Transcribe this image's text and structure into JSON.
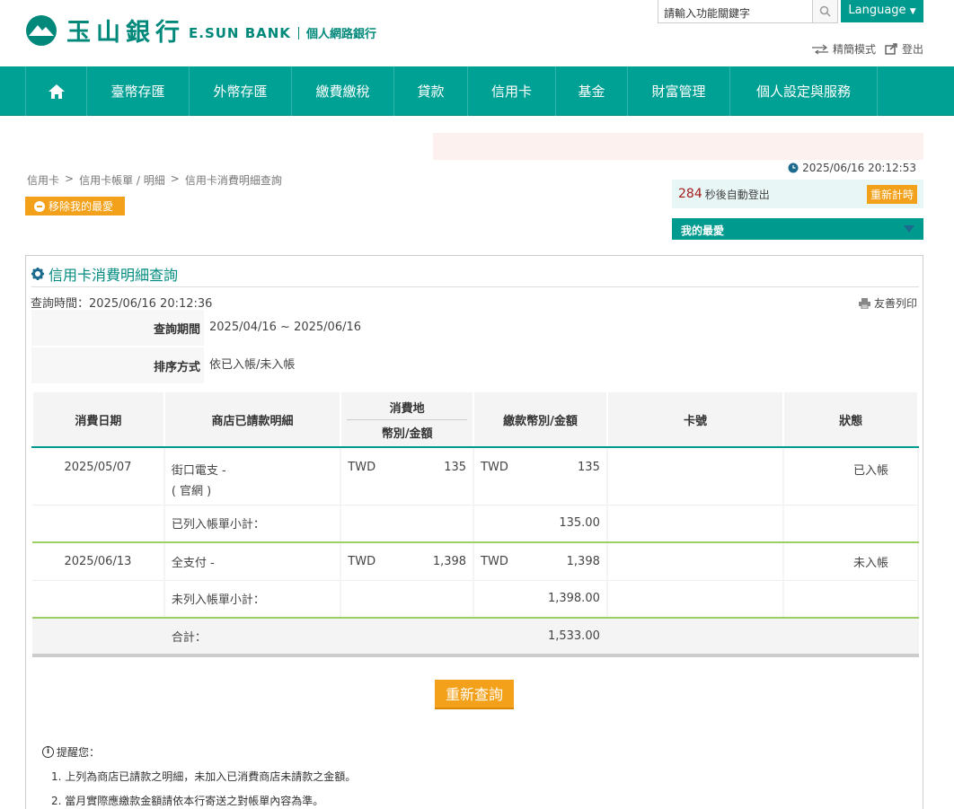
{
  "header": {
    "logo_cn": "玉山銀行",
    "logo_en": "E.SUN BANK",
    "logo_sub": "個人網路銀行",
    "search_placeholder": "請輸入功能關鍵字",
    "language_label": "Language",
    "simple_mode_label": "精簡模式",
    "logout_label": "登出"
  },
  "nav": {
    "items": [
      "臺幣存匯",
      "外幣存匯",
      "繳費繳稅",
      "貸款",
      "信用卡",
      "基金",
      "財富管理",
      "個人設定與服務"
    ]
  },
  "session": {
    "timestamp": "2025/06/16 20:12:53",
    "countdown": "284",
    "countdown_text": "秒後自動登出",
    "reset_label": "重新計時",
    "favorites_label": "我的最愛"
  },
  "breadcrumb": [
    "信用卡",
    "信用卡帳單 / 明細",
    "信用卡消費明細查詢"
  ],
  "remove_favorite_label": "移除我的最愛",
  "panel": {
    "title": "信用卡消費明細查詢",
    "query_time": "查詢時間：2025/06/16 20:12:36",
    "print_label": "友善列印",
    "period_label": "查詢期間",
    "period_value": "2025/04/16 ~ 2025/06/16",
    "sort_label": "排序方式",
    "sort_value": "依已入帳/未入帳"
  },
  "table": {
    "headers": {
      "date": "消費日期",
      "detail": "商店已請款明細",
      "place_top": "消費地",
      "place_bottom": "幣別/金額",
      "pay": "繳款幣別/金額",
      "card": "卡號",
      "status": "狀態"
    },
    "rows": [
      {
        "date": "2025/05/07",
        "detail_line1": "街口電支 -",
        "detail_line2": "( 官網 )",
        "cur1": "TWD",
        "amt1": "135",
        "cur2": "TWD",
        "amt2": "135",
        "card": "",
        "status": "已入帳"
      },
      {
        "date": "2025/06/13",
        "detail_line1": "全支付 -",
        "cur1": "TWD",
        "amt1": "1,398",
        "cur2": "TWD",
        "amt2": "1,398",
        "card": "",
        "status": "未入帳"
      }
    ],
    "subtotal_posted_label": "已列入帳單小計：",
    "subtotal_posted_value": "135.00",
    "subtotal_unposted_label": "未列入帳單小計：",
    "subtotal_unposted_value": "1,398.00",
    "total_label": "合計：",
    "total_value": "1,533.00"
  },
  "requery_label": "重新查詢",
  "notes": {
    "title": "提醒您：",
    "items": [
      "1. 上列為商店已請款之明細，未加入已消費商店未請款之金額。",
      "2. 當月實際應繳款金額請依本行寄送之對帳單內容為準。"
    ]
  },
  "colors": {
    "brand": "#00a195",
    "accent": "#f3a11a",
    "unposted": "#d4541d"
  }
}
